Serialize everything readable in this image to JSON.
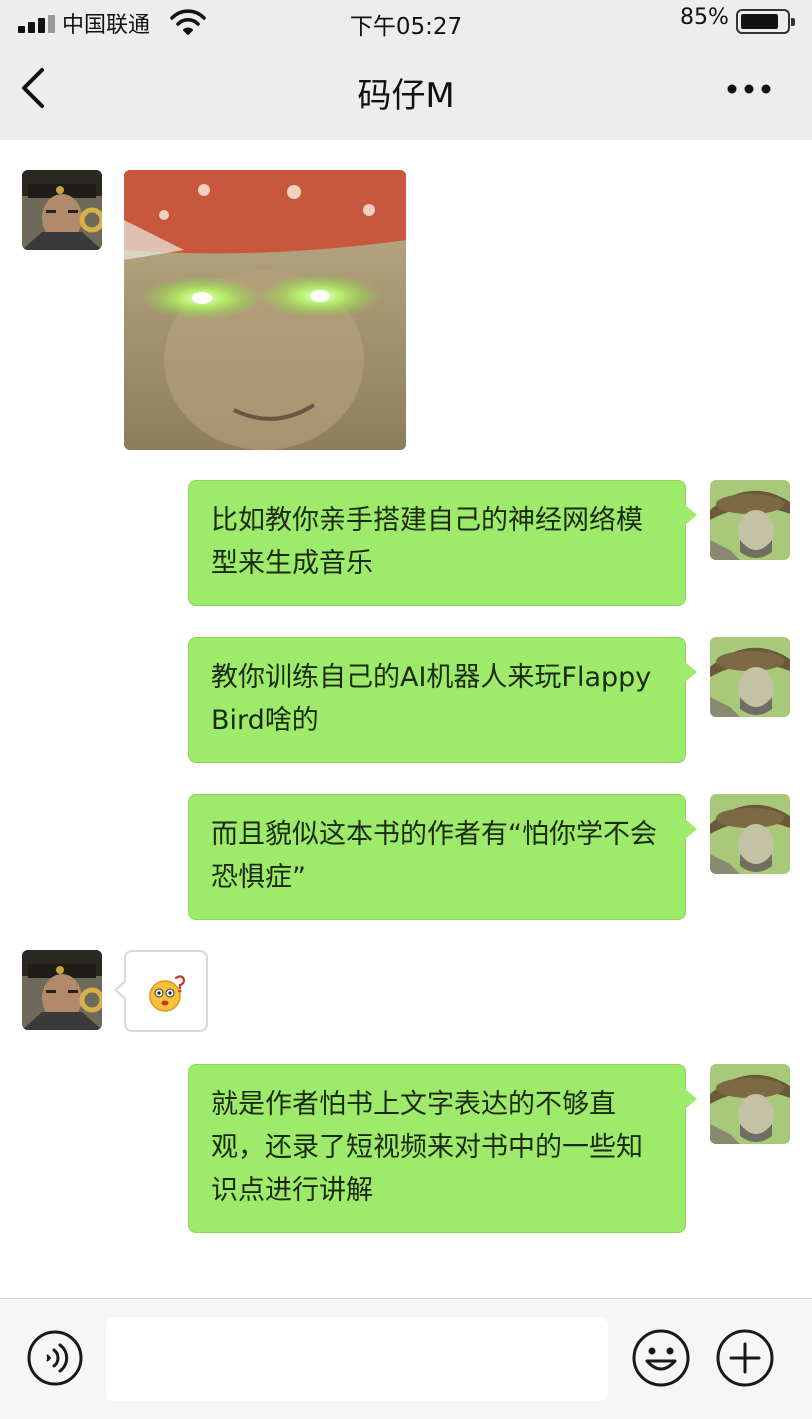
{
  "status_bar": {
    "carrier": "中国联通",
    "time": "下午05:27",
    "battery_percent": "85%",
    "battery_level": 0.85
  },
  "nav": {
    "title": "码仔M"
  },
  "messages": [
    {
      "from": "contact",
      "type": "image"
    },
    {
      "from": "me",
      "type": "text",
      "text": "比如教你亲手搭建自己的神经网络模型来生成音乐"
    },
    {
      "from": "me",
      "type": "text",
      "text": "教你训练自己的AI机器人来玩FlappyBird啥的"
    },
    {
      "from": "me",
      "type": "text",
      "text": "而且貌似这本书的作者有“怕你学不会恐惧症”"
    },
    {
      "from": "contact",
      "type": "emoji",
      "icon": "confused-face-emoji"
    },
    {
      "from": "me",
      "type": "text",
      "text": "就是作者怕书上文字表达的不够直观，还录了短视频来对书中的一些知识点进行讲解"
    }
  ],
  "input_bar": {
    "value": "",
    "icons": [
      "voice-icon",
      "emoji-icon",
      "plus-icon"
    ]
  },
  "colors": {
    "outgoing_bubble": "#9eea6a",
    "header_bg": "#ededed",
    "chat_bg": "#ffffff"
  }
}
